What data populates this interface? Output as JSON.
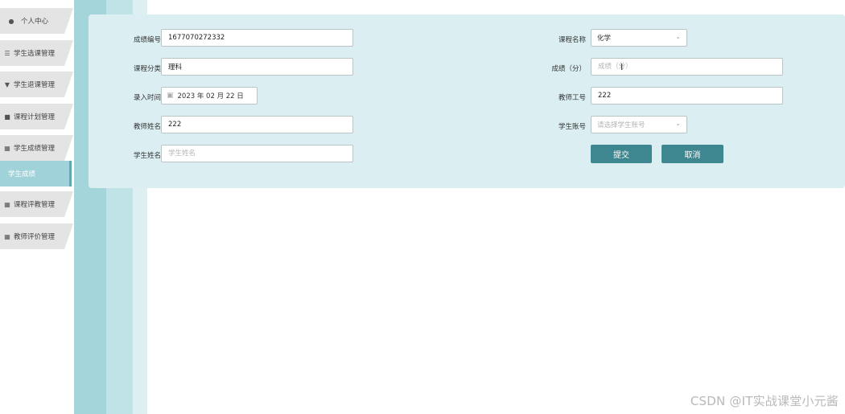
{
  "sidebar": {
    "items": [
      {
        "label": "个人中心",
        "icon": "person-icon"
      },
      {
        "label": "学生选课管理",
        "icon": "sliders-icon"
      },
      {
        "label": "学生退课管理",
        "icon": "stand-icon"
      },
      {
        "label": "课程计划管理",
        "icon": "briefcase-icon"
      },
      {
        "label": "学生成绩管理",
        "icon": "grid-icon"
      },
      {
        "label": "学生成绩",
        "icon": ""
      },
      {
        "label": "课程评教管理",
        "icon": "grid-icon"
      },
      {
        "label": "教师评价管理",
        "icon": "grid-icon"
      }
    ]
  },
  "form": {
    "left": {
      "score_id": {
        "label": "成绩编号",
        "value": "1677070272332"
      },
      "course_category": {
        "label": "课程分类",
        "value": "理科"
      },
      "entry_time": {
        "label": "录入时间",
        "value": "2023 年 02 月 22 日"
      },
      "teacher_name": {
        "label": "教师姓名",
        "value": "222"
      },
      "student_name": {
        "label": "学生姓名",
        "placeholder": "学生姓名"
      }
    },
    "right": {
      "course_name": {
        "label": "课程名称",
        "value": "化学"
      },
      "score": {
        "label": "成绩（分）",
        "placeholder": "成绩（分）"
      },
      "teacher_id": {
        "label": "教师工号",
        "value": "222"
      },
      "student_account": {
        "label": "学生账号",
        "placeholder": "请选择学生账号"
      }
    },
    "buttons": {
      "submit": "提交",
      "cancel": "取消"
    }
  },
  "watermark": "CSDN @IT实战课堂小元酱",
  "colors": {
    "accent": "#3f8790",
    "panel": "#dbeff2",
    "band": "#a3d5db",
    "active_nav": "#9fd2d9"
  }
}
